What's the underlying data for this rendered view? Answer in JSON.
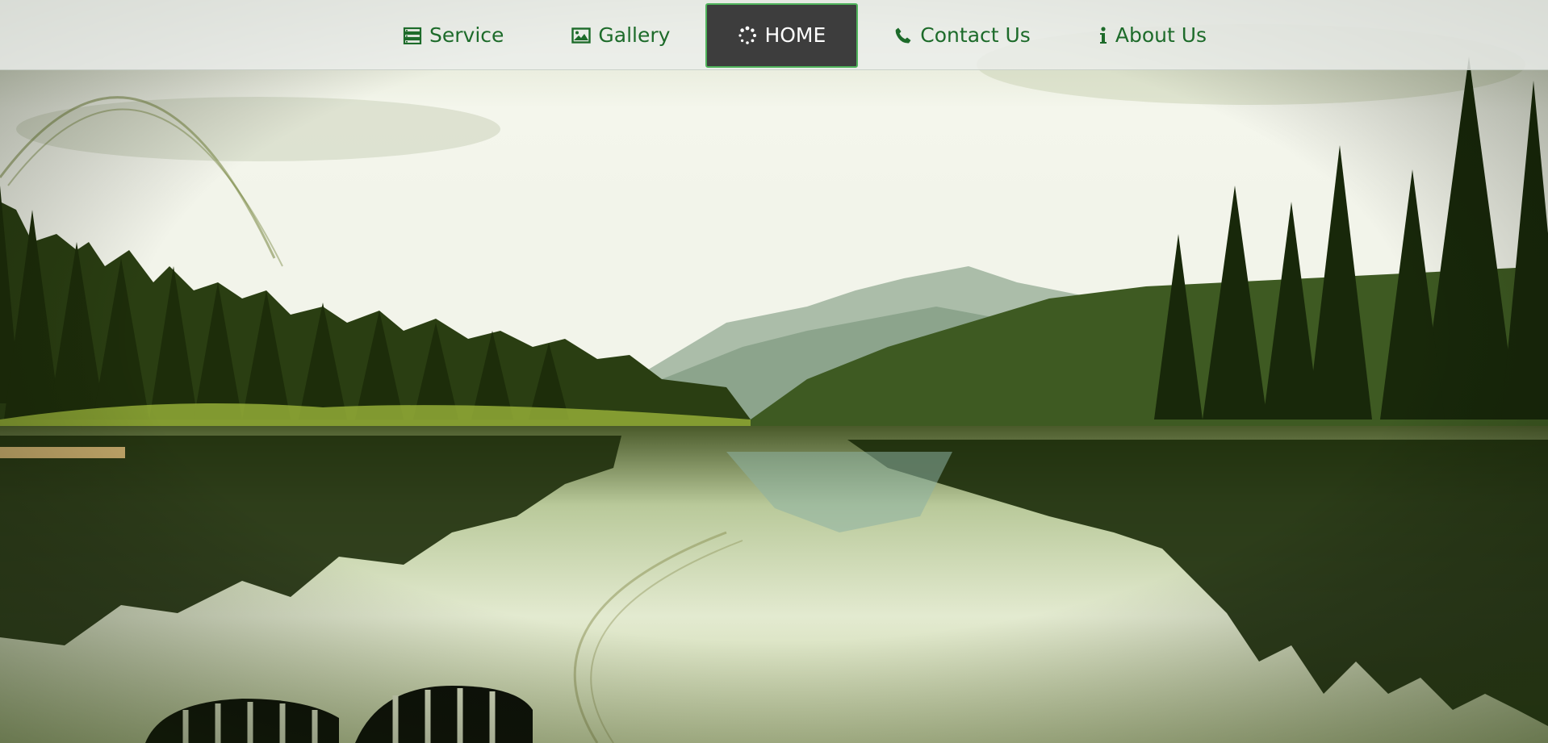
{
  "nav": {
    "items": [
      {
        "label": "Service",
        "icon": "server-icon",
        "active": false
      },
      {
        "label": "Gallery",
        "icon": "picture-icon",
        "active": false
      },
      {
        "label": "HOME",
        "icon": "spinner-icon",
        "active": true
      },
      {
        "label": "Contact Us",
        "icon": "phone-icon",
        "active": false
      },
      {
        "label": "About Us",
        "icon": "info-icon",
        "active": false
      }
    ]
  },
  "colors": {
    "nav_text": "#1d6b2a",
    "active_bg": "#3d3d3d",
    "active_border": "#4fb35b",
    "active_text": "#ffffff"
  },
  "hero": {
    "scene": "lake-forest-landscape"
  }
}
